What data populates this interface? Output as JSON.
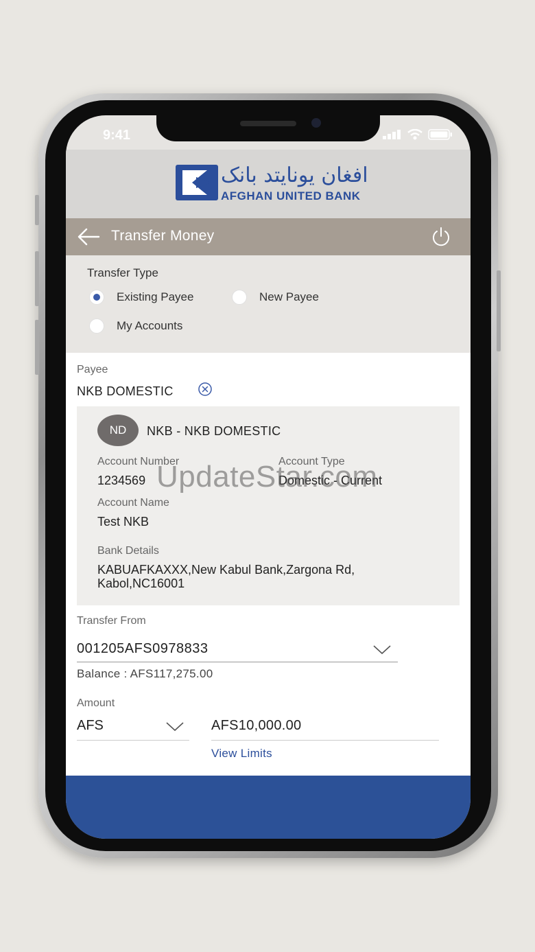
{
  "status_bar": {
    "time": "9:41"
  },
  "brand": {
    "arabic_name": "افغان یونایتد بانک",
    "name": "AFGHAN UNITED BANK",
    "color": "#2b4e9b"
  },
  "header": {
    "title": "Transfer Money",
    "background": "#a69d93"
  },
  "transfer_type": {
    "label": "Transfer Type",
    "options": [
      {
        "label": "Existing Payee",
        "selected": true
      },
      {
        "label": "New Payee",
        "selected": false
      },
      {
        "label": "My Accounts",
        "selected": false
      }
    ]
  },
  "payee": {
    "label": "Payee",
    "name": "NKB DOMESTIC",
    "card": {
      "initials": "ND",
      "title": "NKB - NKB DOMESTIC",
      "account_number_label": "Account Number",
      "account_number": "1234569",
      "account_type_label": "Account Type",
      "account_type": "Domestic - Current",
      "account_name_label": "Account Name",
      "account_name": "Test NKB",
      "bank_details_label": "Bank Details",
      "bank_details_line1": "KABUAFKAXXX,New Kabul Bank,Zargona Rd,",
      "bank_details_line2": "Kabol,NC16001"
    }
  },
  "transfer_from": {
    "label": "Transfer From",
    "account": "001205AFS0978833",
    "balance": "Balance : AFS117,275.00"
  },
  "amount": {
    "label": "Amount",
    "currency": "AFS",
    "value": "AFS10,000.00",
    "view_limits": "View Limits"
  },
  "watermark": "UpdateStar.com",
  "colors": {
    "accent": "#3a5aa8",
    "footer": "#2c5197"
  }
}
